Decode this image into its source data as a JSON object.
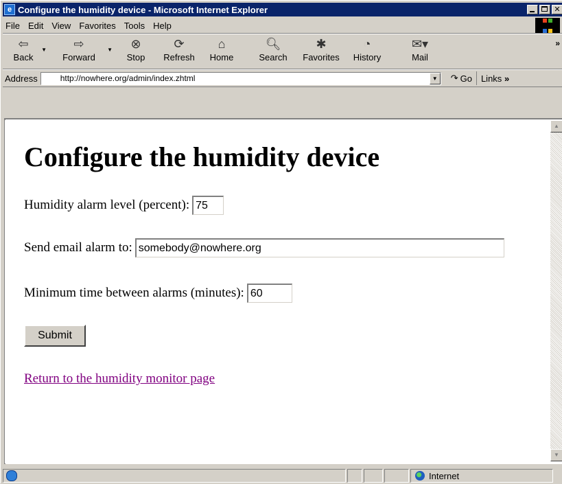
{
  "window": {
    "title": "Configure the humidity device - Microsoft Internet Explorer"
  },
  "menu": {
    "file": "File",
    "edit": "Edit",
    "view": "View",
    "favorites": "Favorites",
    "tools": "Tools",
    "help": "Help"
  },
  "toolbar": {
    "back": "Back",
    "forward": "Forward",
    "stop": "Stop",
    "refresh": "Refresh",
    "home": "Home",
    "search": "Search",
    "favorites": "Favorites",
    "history": "History",
    "mail": "Mail"
  },
  "address": {
    "label": "Address",
    "url": "http://nowhere.org/admin/index.zhtml",
    "go": "Go",
    "links": "Links"
  },
  "page": {
    "heading": "Configure the humidity device",
    "humidity_label": "Humidity alarm level (percent):",
    "humidity_value": "75",
    "email_label": "Send email alarm to:",
    "email_value": "somebody@nowhere.org",
    "interval_label": "Minimum time between alarms (minutes):",
    "interval_value": "60",
    "submit_label": "Submit",
    "return_link": "Return to the humidity monitor page"
  },
  "status": {
    "zone": "Internet"
  },
  "colors": {
    "titlebar": "#0a246a",
    "visited_link": "#800080",
    "chrome": "#d4d0c8"
  }
}
